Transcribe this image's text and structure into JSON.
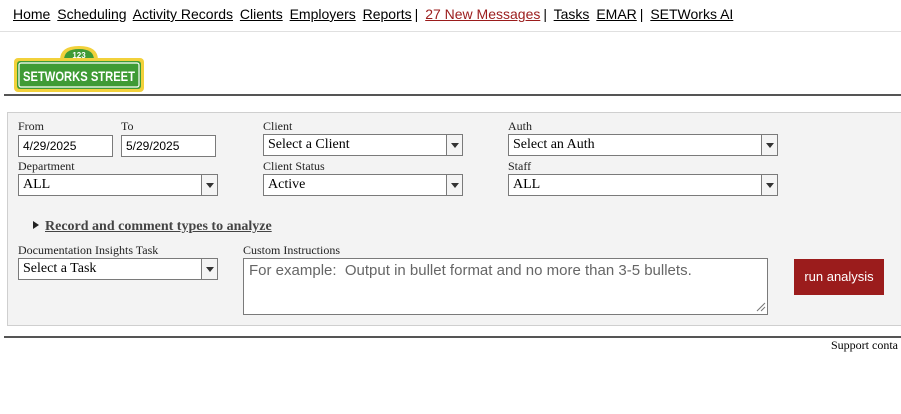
{
  "nav": {
    "items": [
      "Home",
      "Scheduling",
      "Activity Records",
      "Clients",
      "Employers",
      "Reports"
    ],
    "messages": "27 New Messages",
    "after": [
      "Tasks",
      "EMAR"
    ],
    "ai": "SETWorks AI",
    "separator": "|"
  },
  "logo": {
    "number": "123",
    "text": "SETWORKS STREET",
    "colors": {
      "green": "#3f9b35",
      "yellow": "#f2d13b"
    }
  },
  "form": {
    "from_label": "From",
    "from_value": "4/29/2025",
    "to_label": "To",
    "to_value": "5/29/2025",
    "client_label": "Client",
    "client_value": "Select a Client",
    "auth_label": "Auth",
    "auth_value": "Select an Auth",
    "department_label": "Department",
    "department_value": "ALL",
    "client_status_label": "Client Status",
    "client_status_value": "Active",
    "staff_label": "Staff",
    "staff_value": "ALL",
    "record_toggle": "Record and comment types to analyze",
    "task_label": "Documentation Insights Task",
    "task_value": "Select a Task",
    "custom_label": "Custom Instructions",
    "custom_placeholder": "For example:  Output in bullet format and no more than 3-5 bullets.",
    "custom_value": "",
    "run_button": "run analysis"
  },
  "footer": {
    "support": "Support conta"
  },
  "colors": {
    "accent": "#9b1c1c",
    "panel": "#f3f3f3"
  }
}
